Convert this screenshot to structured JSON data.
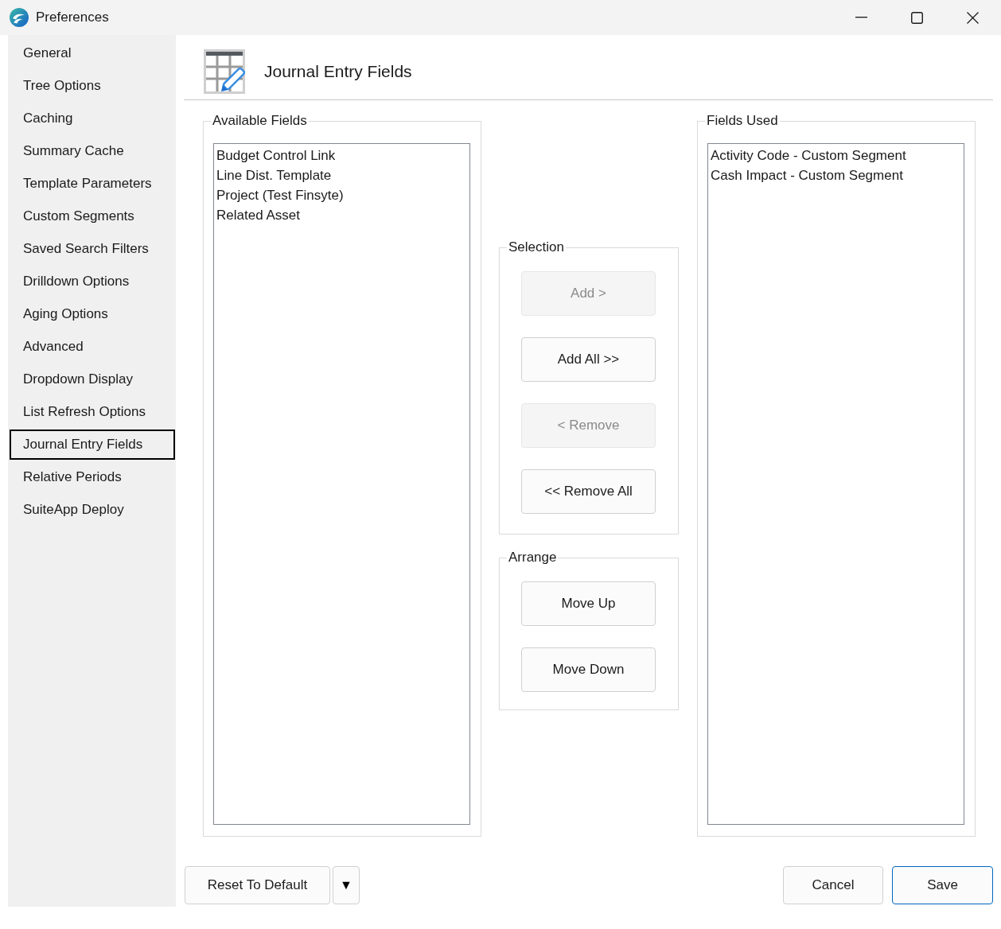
{
  "window": {
    "title": "Preferences"
  },
  "sidebar": {
    "items": [
      {
        "label": "General",
        "selected": false
      },
      {
        "label": "Tree Options",
        "selected": false
      },
      {
        "label": "Caching",
        "selected": false
      },
      {
        "label": "Summary Cache",
        "selected": false
      },
      {
        "label": "Template Parameters",
        "selected": false
      },
      {
        "label": "Custom Segments",
        "selected": false
      },
      {
        "label": "Saved Search Filters",
        "selected": false
      },
      {
        "label": "Drilldown Options",
        "selected": false
      },
      {
        "label": "Aging Options",
        "selected": false
      },
      {
        "label": "Advanced",
        "selected": false
      },
      {
        "label": "Dropdown Display",
        "selected": false
      },
      {
        "label": "List Refresh Options",
        "selected": false
      },
      {
        "label": "Journal Entry Fields",
        "selected": true
      },
      {
        "label": "Relative Periods",
        "selected": false
      },
      {
        "label": "SuiteApp Deploy",
        "selected": false
      }
    ]
  },
  "header": {
    "title": "Journal Entry Fields"
  },
  "available_fields": {
    "label": "Available Fields",
    "items": [
      {
        "text": "Budget Control Link",
        "selected": false
      },
      {
        "text": "Line Dist. Template",
        "selected": false
      },
      {
        "text": "Project (Test Finsyte)",
        "selected": false
      },
      {
        "text": "Related Asset",
        "selected": false
      }
    ]
  },
  "selection": {
    "label": "Selection",
    "buttons": [
      {
        "label": "Add >",
        "disabled": true
      },
      {
        "label": "Add All >>",
        "disabled": false
      },
      {
        "label": "< Remove",
        "disabled": true
      },
      {
        "label": "<< Remove All",
        "disabled": false
      }
    ]
  },
  "arrange": {
    "label": "Arrange",
    "buttons": [
      {
        "label": "Move Up",
        "disabled": false
      },
      {
        "label": "Move Down",
        "disabled": false
      }
    ]
  },
  "fields_used": {
    "label": "Fields Used",
    "items": [
      {
        "text": "Activity Code - Custom Segment",
        "selected": false
      },
      {
        "text": "Cash Impact - Custom Segment",
        "selected": false
      }
    ]
  },
  "footer": {
    "left_buttons": [
      {
        "label": "Reset To Default",
        "kind": "button"
      },
      {
        "label": "▼",
        "kind": "dropdown"
      }
    ],
    "right_buttons": [
      {
        "label": "Cancel",
        "default": false
      },
      {
        "label": "Save",
        "default": true
      }
    ]
  }
}
